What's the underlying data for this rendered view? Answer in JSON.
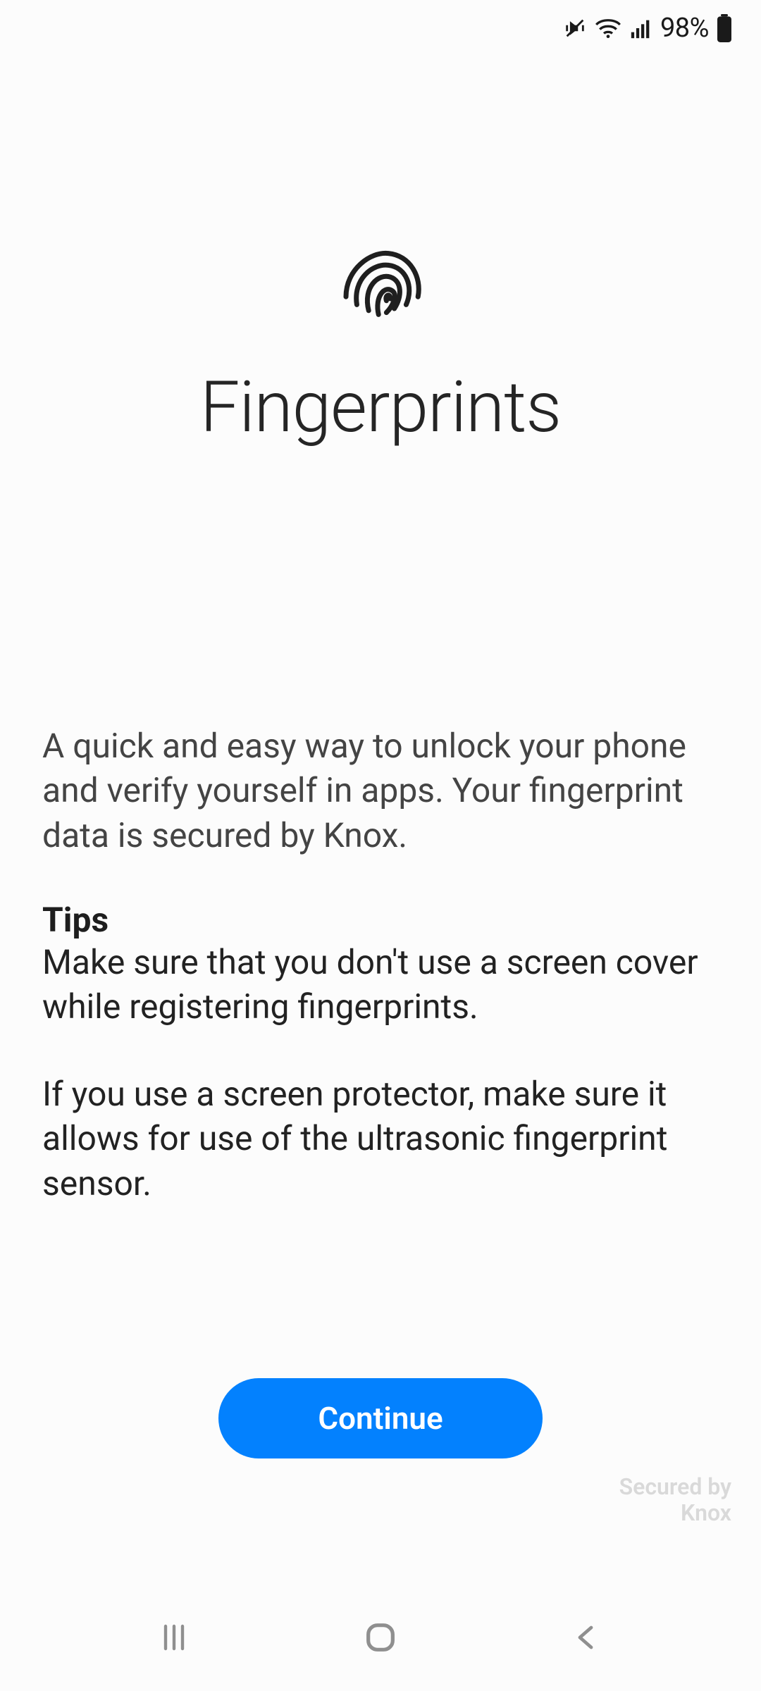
{
  "status": {
    "battery_percent": "98%"
  },
  "hero": {
    "title": "Fingerprints"
  },
  "body": {
    "intro": "A quick and easy way to unlock your phone and verify yourself in apps. Your fingerprint data is secured by Knox.",
    "tips_heading": "Tips",
    "tip1": "Make sure that you don't use a screen cover while registering fingerprints.",
    "tip2": "If you use a screen protector, make sure it allows for use of the ultrasonic fingerprint sensor."
  },
  "actions": {
    "continue_label": "Continue"
  },
  "footer": {
    "secured_line1": "Secured by",
    "secured_line2": "Knox"
  }
}
